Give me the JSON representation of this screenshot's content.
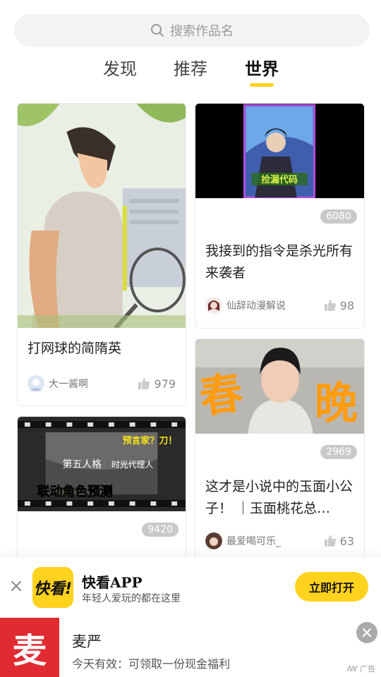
{
  "search": {
    "placeholder": "搜索作品名"
  },
  "tabs": [
    {
      "label": "发现"
    },
    {
      "label": "推荐"
    },
    {
      "label": "世界"
    }
  ],
  "active_tab": "世界",
  "cards": [
    {
      "title": "打网球的简隋英",
      "author": "大一酱啊",
      "likes": "979"
    },
    {
      "cover_text": "捡漏代码",
      "count": "6080",
      "title": "我接到的指令是杀光所有来袭者",
      "author": "仙辞动漫解说",
      "likes": "98"
    },
    {
      "cover_text": [
        "春",
        "晚"
      ],
      "count": "2969",
      "title": "这才是小说中的玉面小公子！ ｜玉面桃花总…",
      "author": "最爱喝可乐_",
      "likes": "63"
    },
    {
      "cover_text": [
        "预言家？刀！",
        "第五人格",
        "时光代理人",
        "联动角色预测"
      ],
      "count": "9420"
    }
  ],
  "app_banner": {
    "icon_text": "快看!",
    "name": "快看APP",
    "desc": "年轻人爱玩的都在这里",
    "button": "立即打开"
  },
  "ad_banner": {
    "logo_text": "麦",
    "name": "麦严",
    "desc": "今天有效：可领取一份现金福利",
    "tag": "广告"
  },
  "colors": {
    "accent": "#ffd21e",
    "ad_red": "#e02b32"
  }
}
